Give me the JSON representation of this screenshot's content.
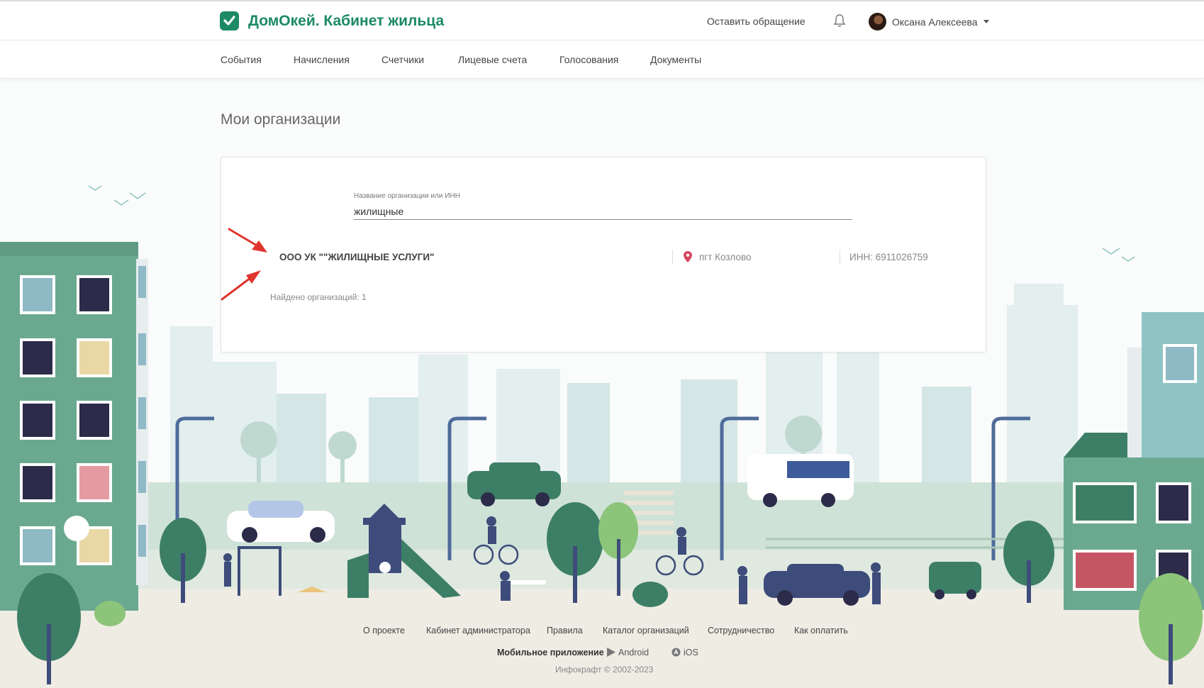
{
  "header": {
    "title": "ДомОкей. Кабинет жильца",
    "appeal_label": "Оставить обращение",
    "bell_icon": "bell-icon",
    "user_name": "Оксана Алексеева"
  },
  "nav": {
    "items": [
      "События",
      "Начисления",
      "Счетчики",
      "Лицевые счета",
      "Голосования",
      "Документы"
    ]
  },
  "page": {
    "title": "Мои организации"
  },
  "search": {
    "label": "Название организации или ИНН",
    "value": "жилищные"
  },
  "result": {
    "name": "ООО УК \"\"ЖИЛИЩНЫЕ УСЛУГИ\"",
    "city": "пгт Козлово",
    "inn": "ИНН: 6911026759",
    "pin_icon": "map-pin-icon"
  },
  "found_text": "Найдено организаций: 1",
  "footer": {
    "links": [
      "О проекте",
      "Кабинет администратора",
      "Правила",
      "Каталог организаций",
      "Сотрудничество",
      "Как оплатить"
    ],
    "mobile_label": "Мобильное приложение",
    "android": "Android",
    "ios": "iOS",
    "copyright": "Инфокрафт © 2002-2023"
  },
  "colors": {
    "brand": "#1c8a63",
    "arrow": "#e0342d",
    "pin": "#d9455f"
  }
}
